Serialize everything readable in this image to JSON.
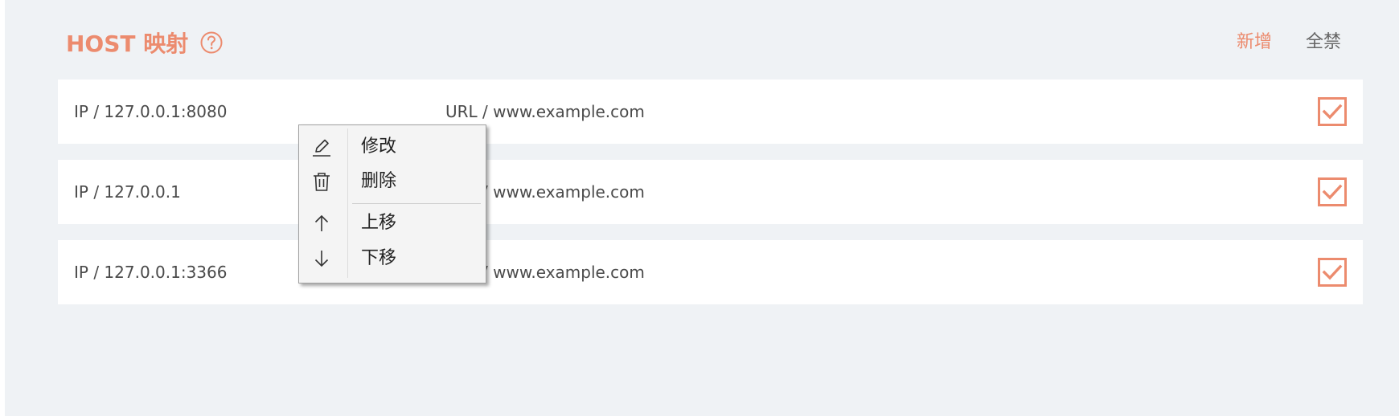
{
  "header": {
    "title": "HOST 映射",
    "help_icon": "question-circle-icon",
    "add_label": "新增",
    "disable_all_label": "全禁"
  },
  "rows": [
    {
      "ip": "IP / 127.0.0.1:8080",
      "url": "URL / www.example.com",
      "enabled": true
    },
    {
      "ip": "IP / 127.0.0.1",
      "url": "URL / www.example.com",
      "enabled": true
    },
    {
      "ip": "IP / 127.0.0.1:3366",
      "url": "URL / www.example.com",
      "enabled": true
    }
  ],
  "context_menu": {
    "items": [
      {
        "label": "修改",
        "icon": "pencil-icon"
      },
      {
        "label": "删除",
        "icon": "trash-icon"
      },
      {
        "label": "上移",
        "icon": "arrow-up-icon"
      },
      {
        "label": "下移",
        "icon": "arrow-down-icon"
      }
    ]
  },
  "colors": {
    "accent": "#ec8b6e",
    "background": "#eff2f5",
    "row_background": "#ffffff",
    "text": "#4a4a4a"
  }
}
